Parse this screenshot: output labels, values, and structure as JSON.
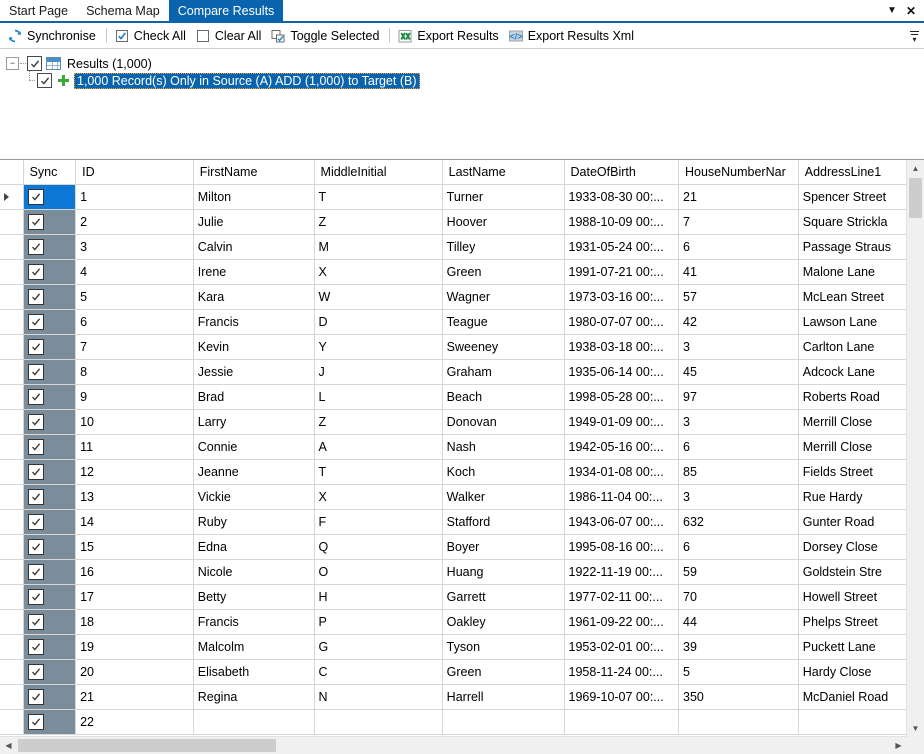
{
  "tabs": [
    {
      "label": "Start Page",
      "active": false
    },
    {
      "label": "Schema Map",
      "active": false
    },
    {
      "label": "Compare Results",
      "active": true
    }
  ],
  "tab_buttons": {
    "dropdown": "▼",
    "close": "✕"
  },
  "toolbar": {
    "items": [
      {
        "label": "Synchronise",
        "icon": "synchronise-icon"
      },
      {
        "label": "Check All",
        "icon": "checked-checkbox-icon"
      },
      {
        "label": "Clear All",
        "icon": "empty-checkbox-icon"
      },
      {
        "label": "Toggle Selected",
        "icon": "toggle-checkbox-icon"
      },
      {
        "label": "Export Results",
        "icon": "excel-icon"
      },
      {
        "label": "Export Results Xml",
        "icon": "xml-icon"
      }
    ]
  },
  "tree": {
    "root": {
      "label": "Results (1,000)",
      "expander": "−",
      "checked": true,
      "icon": "grid-icon"
    },
    "child": {
      "label": "1,000 Record(s) Only in Source (A) ADD (1,000) to Target (B)",
      "checked": true,
      "icon": "add-plus-icon",
      "selected": true
    }
  },
  "grid": {
    "columns": [
      "Sync",
      "ID",
      "FirstName",
      "MiddleInitial",
      "LastName",
      "DateOfBirth",
      "HouseNumberNar",
      "AddressLine1"
    ],
    "rows": [
      {
        "sync": true,
        "id": "1",
        "first": "Milton",
        "middle": "T",
        "last": "Turner",
        "dob": "1933-08-30 00:...",
        "house": "21",
        "addr": "Spencer Street",
        "current": true
      },
      {
        "sync": true,
        "id": "2",
        "first": "Julie",
        "middle": "Z",
        "last": "Hoover",
        "dob": "1988-10-09 00:...",
        "house": "7",
        "addr": "Square Strickla",
        "current": false
      },
      {
        "sync": true,
        "id": "3",
        "first": "Calvin",
        "middle": "M",
        "last": "Tilley",
        "dob": "1931-05-24 00:...",
        "house": "6",
        "addr": "Passage Straus",
        "current": false
      },
      {
        "sync": true,
        "id": "4",
        "first": "Irene",
        "middle": "X",
        "last": "Green",
        "dob": "1991-07-21 00:...",
        "house": "41",
        "addr": "Malone Lane",
        "current": false
      },
      {
        "sync": true,
        "id": "5",
        "first": "Kara",
        "middle": "W",
        "last": "Wagner",
        "dob": "1973-03-16 00:...",
        "house": "57",
        "addr": "McLean Street",
        "current": false
      },
      {
        "sync": true,
        "id": "6",
        "first": "Francis",
        "middle": "D",
        "last": "Teague",
        "dob": "1980-07-07 00:...",
        "house": "42",
        "addr": "Lawson Lane",
        "current": false
      },
      {
        "sync": true,
        "id": "7",
        "first": "Kevin",
        "middle": "Y",
        "last": "Sweeney",
        "dob": "1938-03-18 00:...",
        "house": "3",
        "addr": "Carlton Lane",
        "current": false
      },
      {
        "sync": true,
        "id": "8",
        "first": "Jessie",
        "middle": "J",
        "last": "Graham",
        "dob": "1935-06-14 00:...",
        "house": "45",
        "addr": "Adcock Lane",
        "current": false
      },
      {
        "sync": true,
        "id": "9",
        "first": "Brad",
        "middle": "L",
        "last": "Beach",
        "dob": "1998-05-28 00:...",
        "house": "97",
        "addr": "Roberts Road",
        "current": false
      },
      {
        "sync": true,
        "id": "10",
        "first": "Larry",
        "middle": "Z",
        "last": "Donovan",
        "dob": "1949-01-09 00:...",
        "house": "3",
        "addr": "Merrill Close",
        "current": false
      },
      {
        "sync": true,
        "id": "11",
        "first": "Connie",
        "middle": "A",
        "last": "Nash",
        "dob": "1942-05-16 00:...",
        "house": "6",
        "addr": "Merrill Close",
        "current": false
      },
      {
        "sync": true,
        "id": "12",
        "first": "Jeanne",
        "middle": "T",
        "last": "Koch",
        "dob": "1934-01-08 00:...",
        "house": "85",
        "addr": "Fields Street",
        "current": false
      },
      {
        "sync": true,
        "id": "13",
        "first": "Vickie",
        "middle": "X",
        "last": "Walker",
        "dob": "1986-11-04 00:...",
        "house": "3",
        "addr": "Rue Hardy",
        "current": false
      },
      {
        "sync": true,
        "id": "14",
        "first": "Ruby",
        "middle": "F",
        "last": "Stafford",
        "dob": "1943-06-07 00:...",
        "house": "632",
        "addr": "Gunter Road",
        "current": false
      },
      {
        "sync": true,
        "id": "15",
        "first": "Edna",
        "middle": "Q",
        "last": "Boyer",
        "dob": "1995-08-16 00:...",
        "house": "6",
        "addr": "Dorsey Close",
        "current": false
      },
      {
        "sync": true,
        "id": "16",
        "first": "Nicole",
        "middle": "O",
        "last": "Huang",
        "dob": "1922-11-19 00:...",
        "house": "59",
        "addr": "Goldstein Stre",
        "current": false
      },
      {
        "sync": true,
        "id": "17",
        "first": "Betty",
        "middle": "H",
        "last": "Garrett",
        "dob": "1977-02-11 00:...",
        "house": "70",
        "addr": "Howell Street",
        "current": false
      },
      {
        "sync": true,
        "id": "18",
        "first": "Francis",
        "middle": "P",
        "last": "Oakley",
        "dob": "1961-09-22 00:...",
        "house": "44",
        "addr": "Phelps Street",
        "current": false
      },
      {
        "sync": true,
        "id": "19",
        "first": "Malcolm",
        "middle": "G",
        "last": "Tyson",
        "dob": "1953-02-01 00:...",
        "house": "39",
        "addr": "Puckett Lane",
        "current": false
      },
      {
        "sync": true,
        "id": "20",
        "first": "Elisabeth",
        "middle": "C",
        "last": "Green",
        "dob": "1958-11-24 00:...",
        "house": "5",
        "addr": "Hardy Close",
        "current": false
      },
      {
        "sync": true,
        "id": "21",
        "first": "Regina",
        "middle": "N",
        "last": "Harrell",
        "dob": "1969-10-07 00:...",
        "house": "350",
        "addr": "McDaniel Road",
        "current": false
      },
      {
        "sync": true,
        "id": "22",
        "first": "",
        "middle": "",
        "last": "",
        "dob": "",
        "house": "",
        "addr": "",
        "current": false
      }
    ]
  },
  "scrollbars": {
    "vertical": {
      "up": "▲",
      "down": "▼"
    },
    "horizontal": {
      "left": "◀",
      "right": "▶"
    }
  },
  "colors": {
    "accent": "#0a64ad",
    "selection": "#0a78d4",
    "sync_column": "#7b8c9b",
    "plus_green": "#3aa93a"
  }
}
